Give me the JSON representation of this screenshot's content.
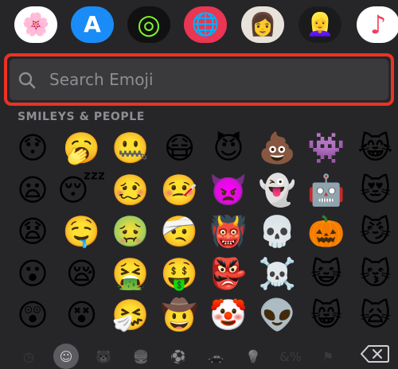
{
  "app_bar": {
    "icons": [
      {
        "name": "photos-icon",
        "glyph": "🌸",
        "bg": "#ffffff"
      },
      {
        "name": "app-store-icon",
        "glyph": "A",
        "bg": "#1a8cf7"
      },
      {
        "name": "fitness-icon",
        "glyph": "◎",
        "bg": "#111111"
      },
      {
        "name": "web-images-icon",
        "glyph": "🌐",
        "bg": "#ea3553"
      },
      {
        "name": "memoji-icon",
        "glyph": "👩",
        "bg": "#e8e3da"
      },
      {
        "name": "memoji-stickers-icon",
        "glyph": "👱‍♀️",
        "bg": "#1b1b1b"
      },
      {
        "name": "music-icon",
        "glyph": "♪",
        "bg": "#ffffff"
      }
    ]
  },
  "search": {
    "placeholder": "Search Emoji",
    "value": ""
  },
  "section_title": "SMILEYS & PEOPLE",
  "emoji_columns": [
    [
      "😯",
      "😦",
      "😧",
      "😮",
      "😲"
    ],
    [
      "🥱",
      "😴",
      "🤤",
      "😪",
      "😵"
    ],
    [
      "🤐",
      "🥴",
      "🤢",
      "🤮",
      "🤧"
    ],
    [
      "😷",
      "🤒",
      "🤕",
      "🤑",
      "🤠"
    ],
    [
      "😈",
      "👿",
      "👹",
      "👺",
      "🤡"
    ],
    [
      "💩",
      "👻",
      "💀",
      "☠️",
      "👽"
    ],
    [
      "👾",
      "🤖",
      "🎃",
      "😺",
      "😸"
    ],
    [
      "😹",
      "😻",
      "😼",
      "😽",
      "🙀"
    ]
  ],
  "categories": [
    {
      "name": "recent-icon",
      "glyph": "◷",
      "active": false
    },
    {
      "name": "smileys-icon",
      "glyph": "☺",
      "active": true
    },
    {
      "name": "animals-icon",
      "glyph": "🐻",
      "active": false
    },
    {
      "name": "food-icon",
      "glyph": "🍔",
      "active": false
    },
    {
      "name": "activity-icon",
      "glyph": "⚽",
      "active": false
    },
    {
      "name": "travel-icon",
      "glyph": "🚗",
      "active": false
    },
    {
      "name": "objects-icon",
      "glyph": "💡",
      "active": false
    },
    {
      "name": "symbols-icon",
      "glyph": "&%",
      "active": false
    },
    {
      "name": "flags-icon",
      "glyph": "⚑",
      "active": false
    }
  ],
  "colors": {
    "background": "#262629",
    "search_field": "#3a3a3d",
    "highlight_outline": "#ec3223",
    "muted_text": "#8e8e93"
  }
}
